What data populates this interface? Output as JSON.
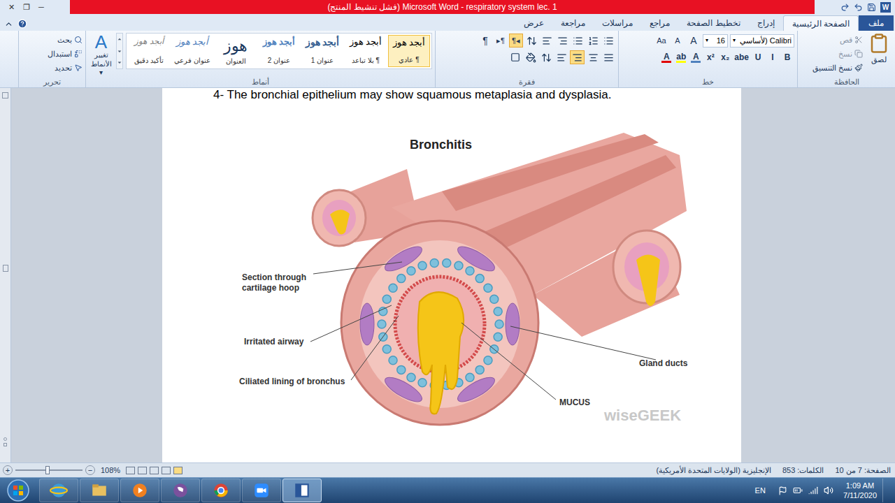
{
  "window": {
    "title": "(فشل تنشيط المنتج) Microsoft Word - respiratory system lec. 1",
    "controls": [
      "✕",
      "❐",
      "─"
    ],
    "app_logo": "W"
  },
  "tabs": [
    {
      "label": "ملف",
      "kind": "file",
      "selected": false
    },
    {
      "label": "الصفحة الرئيسية",
      "kind": "tab",
      "selected": true
    },
    {
      "label": "إدراج",
      "kind": "tab",
      "selected": false
    },
    {
      "label": "تخطيط الصفحة",
      "kind": "tab",
      "selected": false
    },
    {
      "label": "مراجع",
      "kind": "tab",
      "selected": false
    },
    {
      "label": "مراسلات",
      "kind": "tab",
      "selected": false
    },
    {
      "label": "مراجعة",
      "kind": "tab",
      "selected": false
    },
    {
      "label": "عرض",
      "kind": "tab",
      "selected": false
    }
  ],
  "clipboard": {
    "label": "الحافظة",
    "paste": "لصق",
    "items": [
      "قص",
      "نسخ",
      "نسخ التنسيق"
    ]
  },
  "font": {
    "label": "خط",
    "name": "Calibri (لأساسي",
    "size": "16",
    "row1": [
      "A",
      "A",
      "Aa"
    ],
    "row2": [
      {
        "glyph": "B",
        "kind": "plain",
        "color": "#1e395b"
      },
      {
        "glyph": "I",
        "kind": "plain",
        "color": "#1e395b"
      },
      {
        "glyph": "U",
        "kind": "plain",
        "color": "#1e395b"
      },
      {
        "glyph": "abe",
        "kind": "plain",
        "color": "#1e395b"
      },
      {
        "glyph": "x₂",
        "kind": "plain",
        "color": "#1e395b"
      },
      {
        "glyph": "x²",
        "kind": "plain",
        "color": "#1e395b"
      },
      {
        "glyph": "A",
        "kind": "color",
        "color": "#4f81bd"
      },
      {
        "glyph": "ab",
        "kind": "color",
        "color": "#ffff00"
      },
      {
        "glyph": "A",
        "kind": "color",
        "color": "#e00000"
      }
    ]
  },
  "paragraph": {
    "label": "فقرة",
    "marks": "¶",
    "direction": [
      {
        "glyph": "¶◂",
        "selected": true
      },
      {
        "glyph": "▸¶",
        "selected": false
      }
    ],
    "alignments": [
      {
        "selected": false
      },
      {
        "selected": false
      },
      {
        "selected": true
      },
      {
        "selected": false
      }
    ]
  },
  "styles": {
    "label": "أنماط",
    "items": [
      {
        "sample": "أبجد هوز",
        "label": "¶ عادي",
        "selected": true
      },
      {
        "sample": "أبجد هوز",
        "label": "¶ بلا تباعد",
        "selected": false
      },
      {
        "sample": "أبجد هوز",
        "label": "عنوان 1",
        "selected": false
      },
      {
        "sample": "أبجد هوز",
        "label": "عنوان 2",
        "selected": false
      },
      {
        "sample": "هوز",
        "label": "العنوان",
        "selected": false
      },
      {
        "sample": "أبجد هوز",
        "label": "عنوان فرعي",
        "selected": false
      },
      {
        "sample": "أبجد هوز",
        "label": "تأكيد دقيق",
        "selected": false
      }
    ],
    "change": {
      "glyph": "A",
      "label": "تغيير الأنماط"
    }
  },
  "editing": {
    "label": "تحرير",
    "items": [
      "بحث",
      "استبدال",
      "تحديد"
    ]
  },
  "document": {
    "text": "4- The bronchial epithelium may show squamous metaplasia and dysplasia.",
    "figure": {
      "title": "Bronchitis",
      "labels": [
        "Section through cartilage hoop",
        "Irritated airway",
        "Ciliated lining of bronchus",
        "Gland ducts",
        "MUCUS"
      ],
      "credit": "wiseGEEK"
    }
  },
  "status_bar": {
    "items": [
      "الصفحة: 7 من 10",
      "الكلمات: 853",
      "الإنجليزية (الولايات المتحدة الأمريكية)"
    ],
    "zoom": "108%",
    "zoom_level": 0.48,
    "zoom_in": "+",
    "zoom_out": "−"
  },
  "taskbar": {
    "apps": [
      {
        "name": "internet-explorer",
        "selected": false
      },
      {
        "name": "file-explorer",
        "selected": false
      },
      {
        "name": "media-player",
        "selected": false
      },
      {
        "name": "viber",
        "selected": false
      },
      {
        "name": "chrome",
        "selected": false
      },
      {
        "name": "zoom",
        "selected": false
      },
      {
        "name": "word",
        "selected": true
      }
    ],
    "language": "EN",
    "time": "1:09 AM",
    "date": "7/11/2020"
  }
}
